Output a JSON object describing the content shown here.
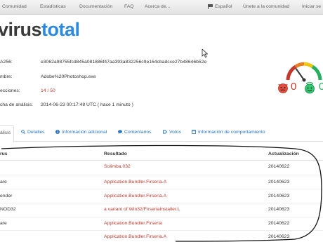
{
  "nav": {
    "items": [
      "Comunidad",
      "Estadísticas",
      "Documentación",
      "FAQ",
      "Acerca de..."
    ],
    "language": "Español",
    "join": "Únete a la comunidad",
    "signin": "Iniciar se"
  },
  "logo": {
    "part1": "virus",
    "part2": "total"
  },
  "info": {
    "sha_label": "A256:",
    "sha_value": "e3062a98755fcd845a081886f47aa393a832256c9e164cbadcce27b48646b52e",
    "name_label": "mbre:",
    "name_value": "Adobe%20Photoshop.exe",
    "ratio_label": "ecciones:",
    "ratio_value": "14 / 50",
    "date_label": "cha de análisis:",
    "date_value": "2014-06-23 00:17:48 UTC ( hace 1 minuto )"
  },
  "votes": {
    "bad": "0",
    "good": "0"
  },
  "gauge": {
    "level": 0.28
  },
  "tabs": [
    "álisis",
    "Detalles",
    "Información adicional",
    "Comentarios",
    "Votos",
    "Información de comportamiento"
  ],
  "table": {
    "headers": [
      "rus",
      "Resultado",
      "Actualización"
    ],
    "rows": [
      [
        "",
        "Solimba.032",
        "20140622"
      ],
      [
        "are",
        "Application.Bundler.Firseria.A",
        "20140623"
      ],
      [
        "ender",
        "Application.Bundler.Firseria.A",
        "20140623"
      ],
      [
        "NOD32",
        "a variant of Win32/FirseriaInstaller.L",
        "20140623"
      ],
      [
        "are",
        "Application.Bundler.Firseria",
        "20140622"
      ],
      [
        "",
        "Application.Bundler.Firseria.A",
        "20140623"
      ]
    ]
  },
  "colors": {
    "brand_dark": "#3a3a3a",
    "brand_blue": "#2b8ae0",
    "alert_red": "#c0392b",
    "link_blue": "#2a76c0"
  }
}
